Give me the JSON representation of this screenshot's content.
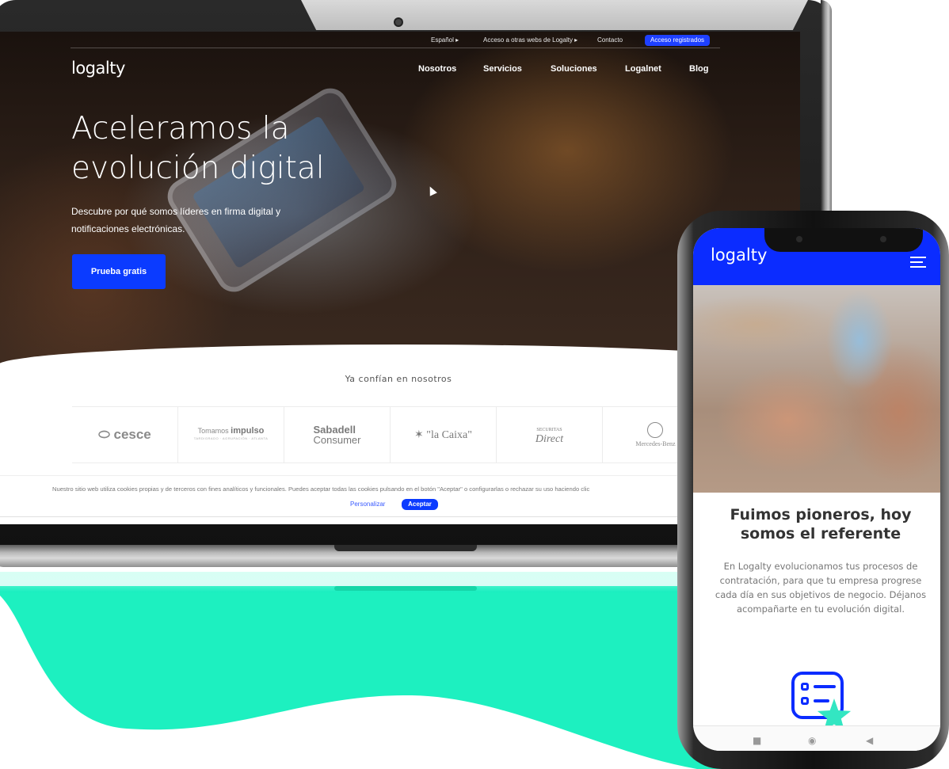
{
  "laptop": {
    "topbar": {
      "language": "Español ▸",
      "other_sites": "Acceso a otras webs de Logalty ▸",
      "contact": "Contacto",
      "registered": "Acceso registrados"
    },
    "logo": "logalty",
    "nav": [
      "Nosotros",
      "Servicios",
      "Soluciones",
      "Logalnet",
      "Blog"
    ],
    "hero": {
      "title": "Aceleramos la evolución digital",
      "subtitle": "Descubre por qué somos líderes en firma digital y notificaciones electrónicas.",
      "cta": "Prueba gratis"
    },
    "trust": {
      "title": "Ya confían en nosotros",
      "logos": {
        "cesce": "cesce",
        "impulso_small": "Tomamos",
        "impulso_bold": "impulso",
        "impulso_tag": "TARDIGRADO · AGRUPACIÓN · ATLANTA",
        "sabadell_1": "Sabadell",
        "sabadell_2": "Consumer",
        "caixa": "\"la Caixa\"",
        "direct_top": "SECURITAS",
        "direct": "Direct",
        "mercedes": "Mercedes-Benz"
      }
    },
    "cookie": {
      "text": "Nuestro sitio web utiliza cookies propias y de terceros con fines analíticos y funcionales. Puedes aceptar todas las cookies pulsando en el botón \"Aceptar\" o configurarlas o rechazar su uso haciendo clic",
      "customize": "Personalizar",
      "accept": "Aceptar"
    }
  },
  "phone": {
    "logo": "logalty",
    "heading": "Fuimos pioneros, hoy somos el referente",
    "body": "En Logalty evolucionamos tus procesos de contratación, para que tu empresa progrese cada día en sus objetivos de negocio. Déjanos acompañarte en tu evolución digital.",
    "navbar": [
      "■",
      "◉",
      "◀"
    ]
  },
  "colors": {
    "brand_blue": "#0b2cff",
    "teal": "#1df0c0"
  }
}
